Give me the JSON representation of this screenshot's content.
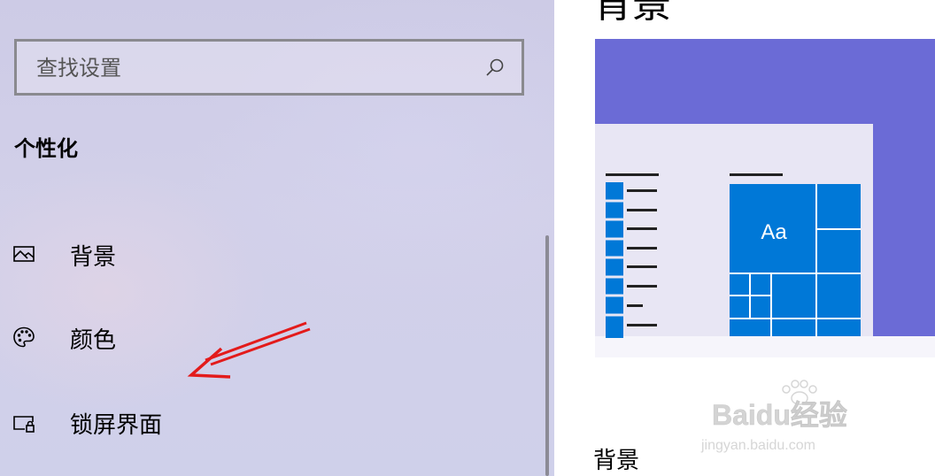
{
  "search": {
    "placeholder": "查找设置"
  },
  "sidebar": {
    "section_title": "个性化",
    "items": [
      {
        "label": "背景",
        "icon": "picture-icon"
      },
      {
        "label": "颜色",
        "icon": "palette-icon"
      },
      {
        "label": "锁屏界面",
        "icon": "lock-screen-icon"
      }
    ]
  },
  "main": {
    "page_title": "背景",
    "preview": {
      "tile_label": "Aa",
      "colors": {
        "background": "#6b6bd6",
        "window": "#e8e6f4",
        "accent": "#0078d7"
      }
    },
    "subtitle": "背景"
  },
  "watermark": {
    "brand": "Baidu经验",
    "url": "jingyan.baidu.com"
  },
  "annotation": {
    "color": "#ff0000"
  }
}
